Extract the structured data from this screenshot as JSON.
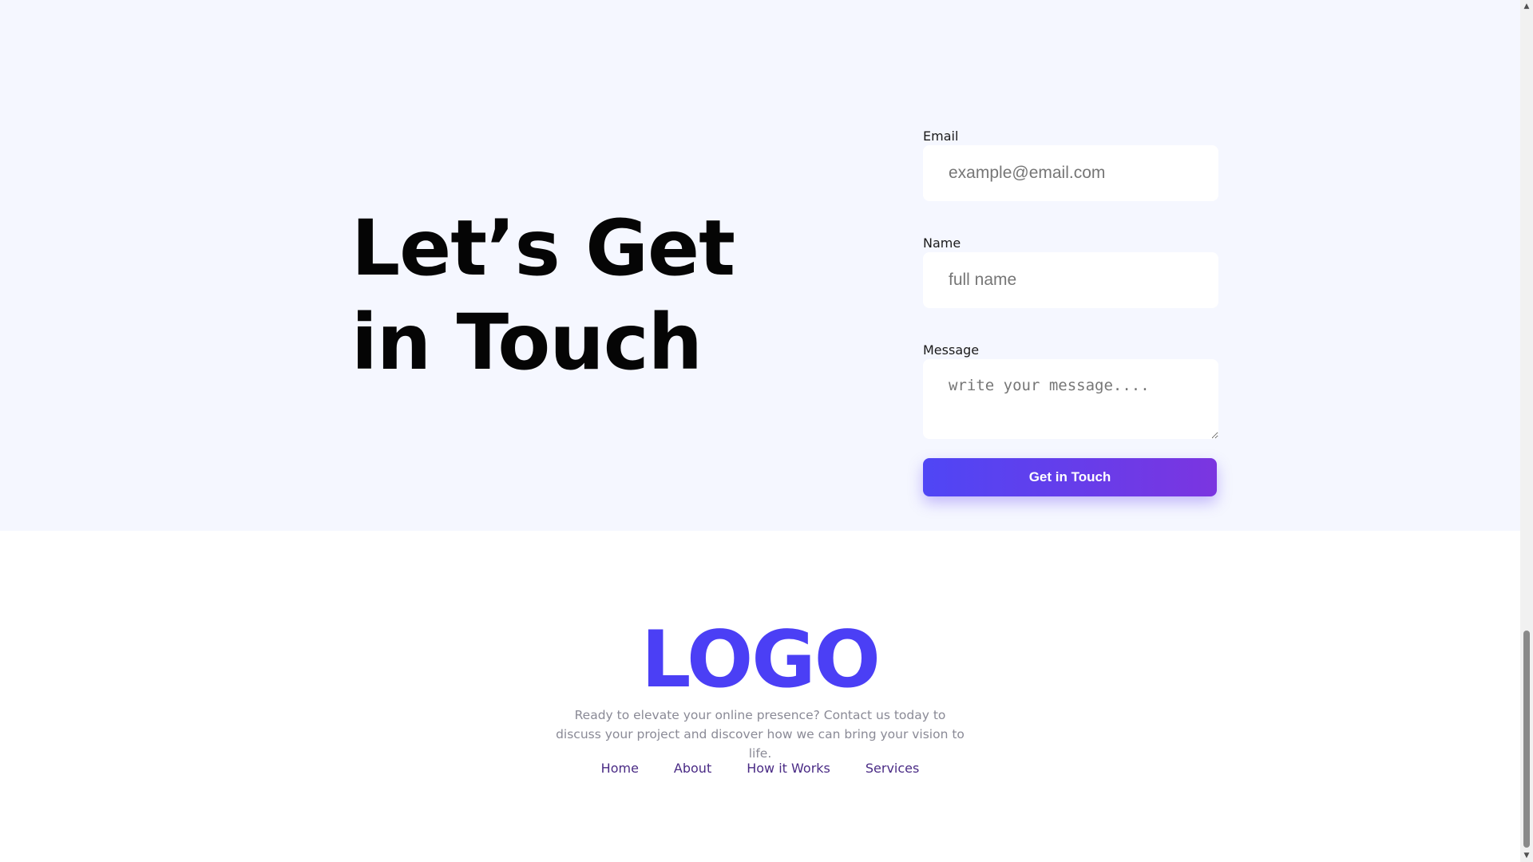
{
  "contact": {
    "heading": "Let’s Get in Touch",
    "form": {
      "email": {
        "label": "Email",
        "placeholder": "example@email.com",
        "value": ""
      },
      "name": {
        "label": "Name",
        "placeholder": "full name",
        "value": ""
      },
      "message": {
        "label": "Message",
        "placeholder": "write your message....",
        "value": ""
      },
      "submit_label": "Get in Touch"
    }
  },
  "footer": {
    "logo": "LOGO",
    "description": "Ready to elevate your online presence? Contact us today to discuss your project and discover how we can bring your vision to life.",
    "nav": [
      {
        "label": "Home"
      },
      {
        "label": "About"
      },
      {
        "label": "How it Works"
      },
      {
        "label": "Services"
      }
    ]
  },
  "scrollbar": {
    "up_icon": "▲",
    "down_icon": "▼"
  },
  "colors": {
    "section_background": "#f5f7ff",
    "brand": "#4b3ff5",
    "button_gradient_start": "#4f46f5",
    "button_gradient_end": "#7b35e0",
    "footer_link": "#4a2b85",
    "footer_text": "#8a8a96"
  },
  "icons": {
    "scroll_up": "scroll-up-arrow-icon",
    "scroll_down": "scroll-down-arrow-icon",
    "textarea_resize": "resize-handle-icon"
  }
}
